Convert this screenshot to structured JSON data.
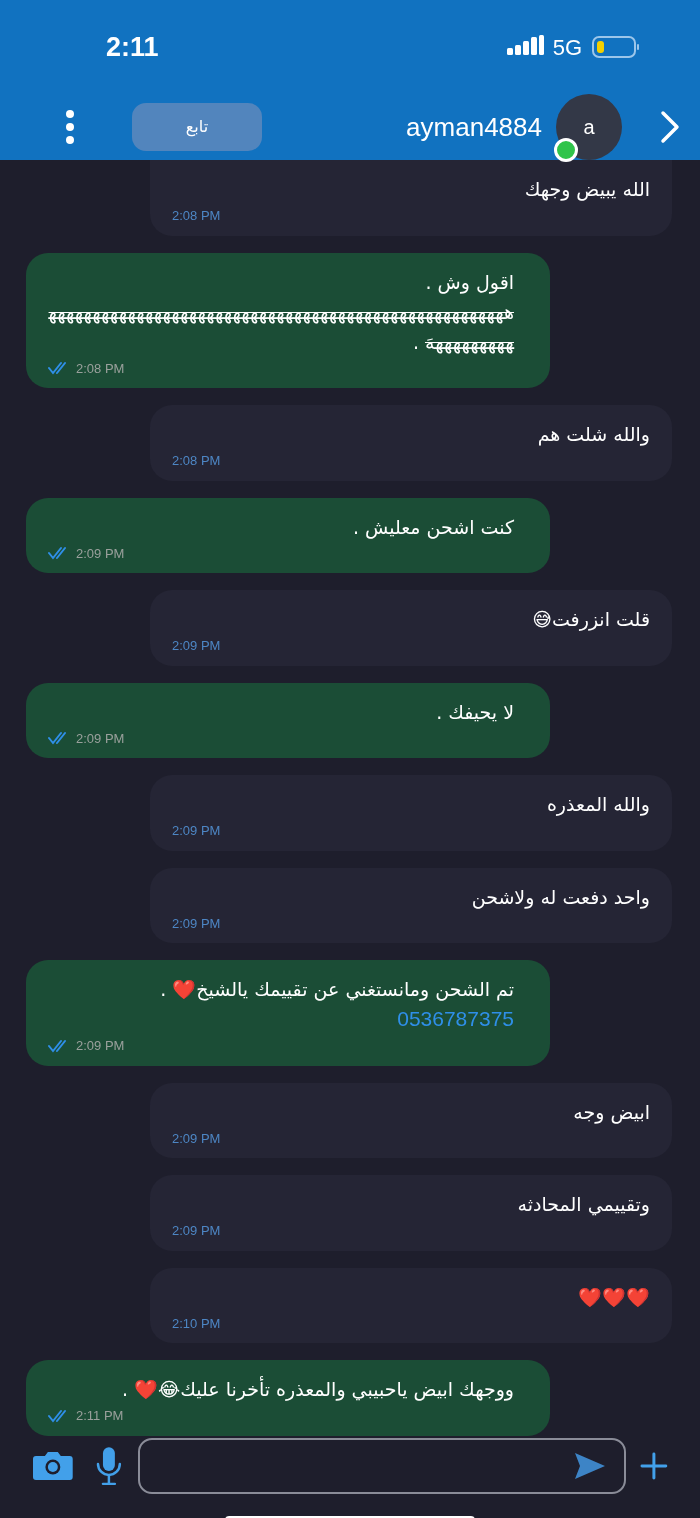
{
  "status_bar": {
    "time": "2:11",
    "network": "5G"
  },
  "header": {
    "follow_button": "تابع",
    "username": "ayman4884",
    "avatar_letter": "a",
    "online": true
  },
  "messages": [
    {
      "kind": "received",
      "text": "الله يبيض وجهك",
      "time": "2:08 PM"
    },
    {
      "kind": "sent",
      "text": "اقول وش .",
      "struck": "هههههههههههههههههههههههههههههههههههههههههههههههههههههههههههههههَ",
      "after": " .",
      "time": "2:08 PM",
      "read": true
    },
    {
      "kind": "received",
      "text": "والله شلت هم",
      "time": "2:08 PM"
    },
    {
      "kind": "sent",
      "text": "كنت اشحن معليش .",
      "time": "2:09 PM",
      "read": true
    },
    {
      "kind": "received",
      "text": "قلت انزرفت😅",
      "time": "2:09 PM"
    },
    {
      "kind": "sent",
      "text": "لا يحيفك .",
      "time": "2:09 PM",
      "read": true
    },
    {
      "kind": "received",
      "text": "والله  المعذره",
      "time": "2:09 PM"
    },
    {
      "kind": "received",
      "text": "واحد دفعت له ولاشحن",
      "time": "2:09 PM"
    },
    {
      "kind": "sent",
      "text": "تم الشحن ومانستغني عن تقييمك يالشيخ❤️ .",
      "link": "0536787375",
      "time": "2:09 PM",
      "read": true
    },
    {
      "kind": "received",
      "text": "ابيض وجه",
      "time": "2:09 PM"
    },
    {
      "kind": "received",
      "text": "وتقييمي المحادثه",
      "time": "2:09 PM"
    },
    {
      "kind": "received",
      "text": "❤️❤️❤️",
      "time": "2:10 PM"
    },
    {
      "kind": "sent",
      "text": "ووجهك ابيض ياحبيبي والمعذره تأخرنا عليك😂❤️ .",
      "time": "2:11 PM",
      "read": true
    }
  ]
}
